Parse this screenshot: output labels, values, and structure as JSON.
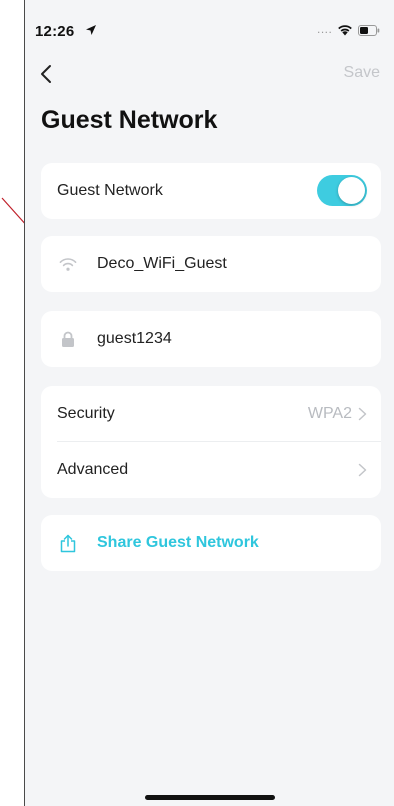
{
  "status_bar": {
    "time": "12:26",
    "location_icon": "location-arrow-icon",
    "signal_indicator": "....",
    "wifi_icon": "wifi-icon",
    "battery_icon": "battery-icon"
  },
  "nav": {
    "back_icon": "chevron-left-icon",
    "save_label": "Save"
  },
  "page": {
    "title": "Guest Network"
  },
  "guest_network_toggle": {
    "label": "Guest Network",
    "enabled": true
  },
  "ssid_field": {
    "icon": "wifi-icon",
    "value": "Deco_WiFi_Guest"
  },
  "password_field": {
    "icon": "lock-icon",
    "value": "guest1234"
  },
  "settings": {
    "security_label": "Security",
    "security_value": "WPA2",
    "advanced_label": "Advanced"
  },
  "share": {
    "icon": "share-icon",
    "label": "Share Guest Network"
  },
  "colors": {
    "accent": "#3ecce0",
    "link": "#2fc6dd",
    "background": "#f4f5f7",
    "annotation_arrow": "#c0202a"
  }
}
